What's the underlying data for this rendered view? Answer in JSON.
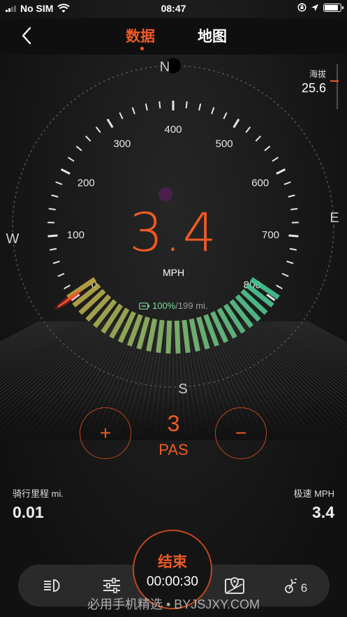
{
  "status_bar": {
    "carrier": "No SIM",
    "time": "08:47",
    "battery_level": 0.9
  },
  "nav": {
    "tabs": [
      {
        "label": "数据",
        "active": true
      },
      {
        "label": "地图",
        "active": false
      }
    ]
  },
  "altitude": {
    "label": "海拔",
    "value": "25.6"
  },
  "compass": {
    "north": "N",
    "east": "E",
    "south": "S",
    "west": "W"
  },
  "speedometer": {
    "speed": "3.4",
    "unit": "MPH",
    "min": 0,
    "max": 800,
    "scale_labels": [
      "0",
      "100",
      "200",
      "300",
      "400",
      "500",
      "600",
      "700",
      "800"
    ]
  },
  "battery": {
    "percent": "100%",
    "range": "/199 mi.",
    "level": 1.0
  },
  "pas": {
    "level": "3",
    "label": "PAS",
    "plus": "+",
    "minus": "−"
  },
  "stats": {
    "distance": {
      "label": "骑行里程 mi.",
      "value": "0.01"
    },
    "max_speed": {
      "label": "极速 MPH",
      "value": "3.4"
    }
  },
  "bottom_bar": {
    "end_label": "结束",
    "duration": "00:00:30",
    "bike_count": "6"
  },
  "watermark": "必用手机精选 • BYJSJXY.COM",
  "colors": {
    "accent": "#f15a24",
    "battery_green": "#7bd99a",
    "background": "#121212"
  }
}
